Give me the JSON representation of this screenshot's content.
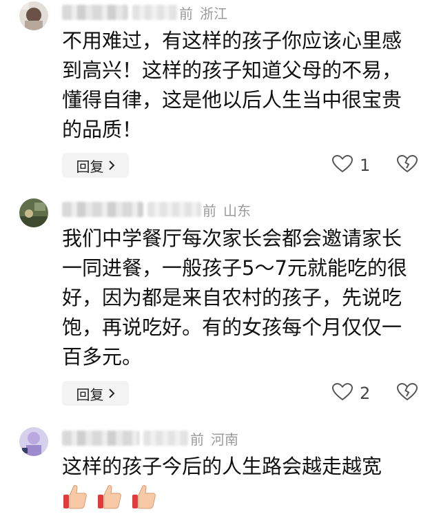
{
  "comments": [
    {
      "time_suffix": "前",
      "location": "浙江",
      "text": "不用难过，有这样的孩子你应该心里感到高兴！这样的孩子知道父母的不易，懂得自律，这是他以后人生当中很宝贵的品质！",
      "reply_label": "回复",
      "like_count": "1"
    },
    {
      "time_suffix": "前",
      "location": "山东",
      "text": "我们中学餐厅每次家长会都会邀请家长一同进餐，一般孩子5～7元就能吃的很好，因为都是来自农村的孩子，先说吃饱，再说吃好。有的女孩每个月仅仅一百多元。",
      "reply_label": "回复",
      "like_count": "2"
    },
    {
      "time_suffix": "前",
      "location": "河南",
      "text": "这样的孩子今后的人生路会越走越宽",
      "reactions": [
        "thumbs-up-emoji",
        "thumbs-up-emoji",
        "thumbs-up-emoji"
      ]
    }
  ],
  "icons": {
    "like": "heart-outline-icon",
    "dislike": "broken-heart-icon",
    "reply_chevron": "chevron-right-icon"
  },
  "colors": {
    "meta_text": "#9a9a9a",
    "body_text": "#111111",
    "reply_bg": "#f3f3f3"
  }
}
